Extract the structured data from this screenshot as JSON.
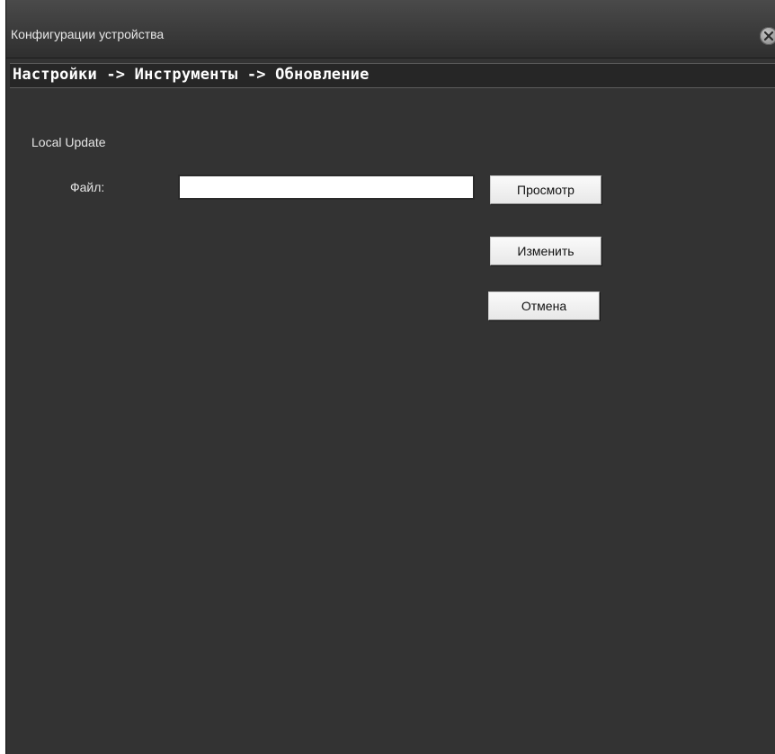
{
  "window": {
    "title": "Конфигурации устройства"
  },
  "breadcrumb": {
    "path": "Настройки -> Инструменты -> Обновление"
  },
  "local_update": {
    "section_title": "Local Update",
    "file_label": "Файл:",
    "file_value": "",
    "browse_label": "Просмотр",
    "apply_label": "Изменить",
    "cancel_label": "Отмена"
  },
  "icons": {
    "close": "close-icon"
  },
  "colors": {
    "background": "#333333",
    "titlebar": "#3b3b3b",
    "breadcrumb_bar": "#262626",
    "text": "#e6e6e6"
  }
}
